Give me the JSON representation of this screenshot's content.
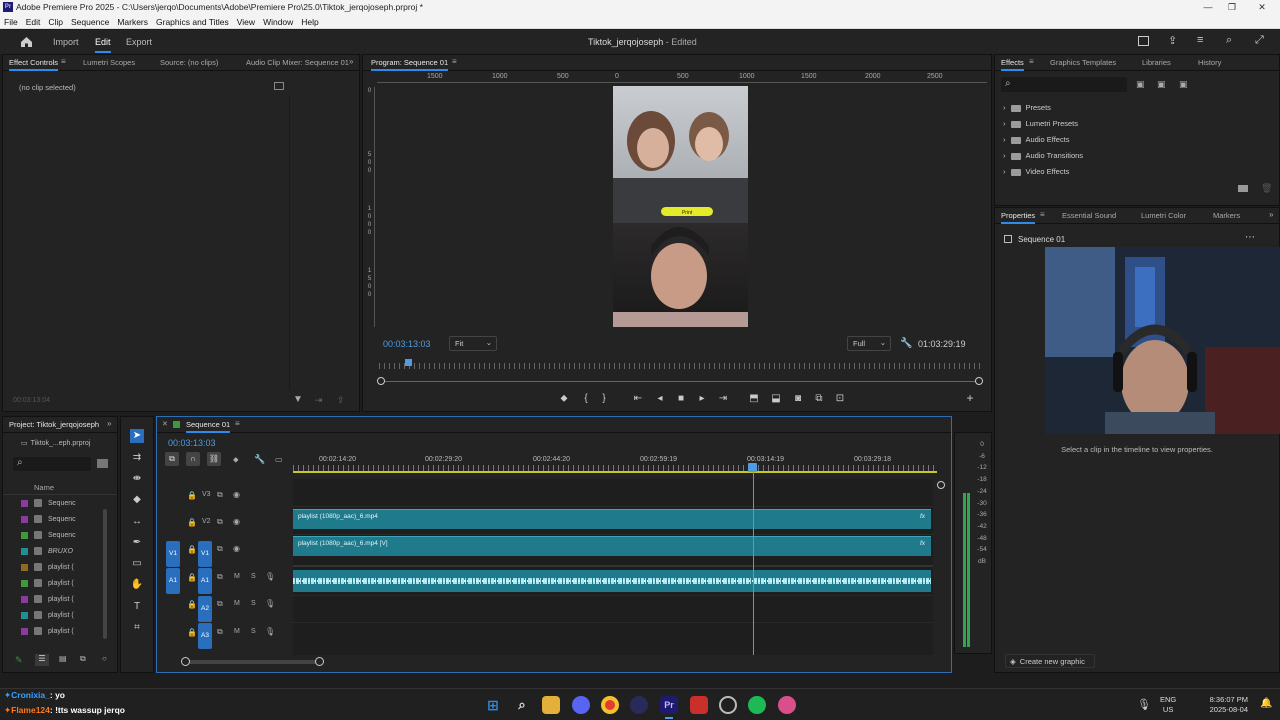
{
  "titlebar": {
    "title": "Adobe Premiere Pro 2025 - C:\\Users\\jerqo\\Documents\\Adobe\\Premiere Pro\\25.0\\Tiktok_jerqojoseph.prproj *",
    "app_badge": "Pr"
  },
  "menu": [
    "File",
    "Edit",
    "Clip",
    "Sequence",
    "Markers",
    "Graphics and Titles",
    "View",
    "Window",
    "Help"
  ],
  "header": {
    "home_icon": "home-icon",
    "import": "Import",
    "edit": "Edit",
    "export": "Export",
    "project_title": "Tiktok_jerqojoseph",
    "status": "- Edited"
  },
  "effect_controls": {
    "tabs": [
      "Effect Controls",
      "Lumetri Scopes",
      "Source: (no clips)",
      "Audio Clip Mixer: Sequence 01"
    ],
    "no_clip": "(no clip selected)",
    "timecode": "00:03:13:04"
  },
  "program": {
    "tab": "Program: Sequence 01",
    "ruler": [
      "1500",
      "1000",
      "500",
      "0",
      "500",
      "1000",
      "1500",
      "2000",
      "2500"
    ],
    "vruler": [
      "0",
      "5",
      "0",
      "0",
      "1",
      "0",
      "0",
      "0",
      "1",
      "5",
      "0",
      "0"
    ],
    "timecode": "00:03:13:03",
    "fit": "Fit",
    "quality": "Full",
    "duration": "01:03:29:19",
    "overlay_badge": "Print"
  },
  "effects": {
    "tabs": [
      "Effects",
      "Graphics Templates",
      "Libraries",
      "History"
    ],
    "folders": [
      "Presets",
      "Lumetri Presets",
      "Audio Effects",
      "Audio Transitions",
      "Video Effects"
    ]
  },
  "properties": {
    "tabs": [
      "Properties",
      "Essential Sound",
      "Lumetri Color",
      "Markers"
    ],
    "sequence": "Sequence 01",
    "hint": "Select a clip in the timeline to view properties.",
    "create_graphic": "Create new graphic"
  },
  "project": {
    "tab": "Project: Tiktok_jerqojoseph",
    "file": "Tiktok_...eph.prproj",
    "name_col": "Name",
    "items": [
      {
        "label": "Sequenc",
        "color": "#8a3b9e"
      },
      {
        "label": "Sequenc",
        "color": "#8a3b9e"
      },
      {
        "label": "Sequenc",
        "color": "#3e9a3a"
      },
      {
        "label": "BRUXO",
        "color": "#1f8f8f"
      },
      {
        "label": "playlist (",
        "color": "#8f6a1f"
      },
      {
        "label": "playlist (",
        "color": "#3e9a3a"
      },
      {
        "label": "playlist (",
        "color": "#8a3b9e"
      },
      {
        "label": "playlist (",
        "color": "#1f8f8f"
      },
      {
        "label": "playlist (",
        "color": "#8a3b9e"
      }
    ]
  },
  "timeline": {
    "tab": "Sequence 01",
    "timecode": "00:03:13:03",
    "ruler": [
      "00:02:14:20",
      "00:02:29:20",
      "00:02:44:20",
      "00:02:59:19",
      "00:03:14:19",
      "00:03:29:18"
    ],
    "tracks": {
      "v3": "V3",
      "v2": "V2",
      "v1": "V1",
      "a1": "A1",
      "a2": "A2",
      "a3": "A3",
      "m": "M",
      "s": "S"
    },
    "clip_v2": "playlist (1080p_aac)_6.mp4",
    "clip_v1": "playlist (1080p_aac)_6.mp4 [V]",
    "fx": "fx"
  },
  "meter": {
    "labels": [
      "0",
      "-6",
      "-12",
      "-18",
      "-24",
      "-30",
      "-36",
      "-42",
      "-48",
      "-54",
      "dB"
    ]
  },
  "chat": [
    {
      "user": "Cronixia_",
      "msg": ": yo",
      "color": "#3aa0ff"
    },
    {
      "user": "Flame124",
      "msg": ": !tts wassup jerqo",
      "color": "#ff7a1a"
    }
  ],
  "taskbar": {
    "lang": "ENG",
    "region": "US",
    "time": "8:36:07 PM",
    "date": "2025-08-04",
    "pr_label": "Pr"
  }
}
